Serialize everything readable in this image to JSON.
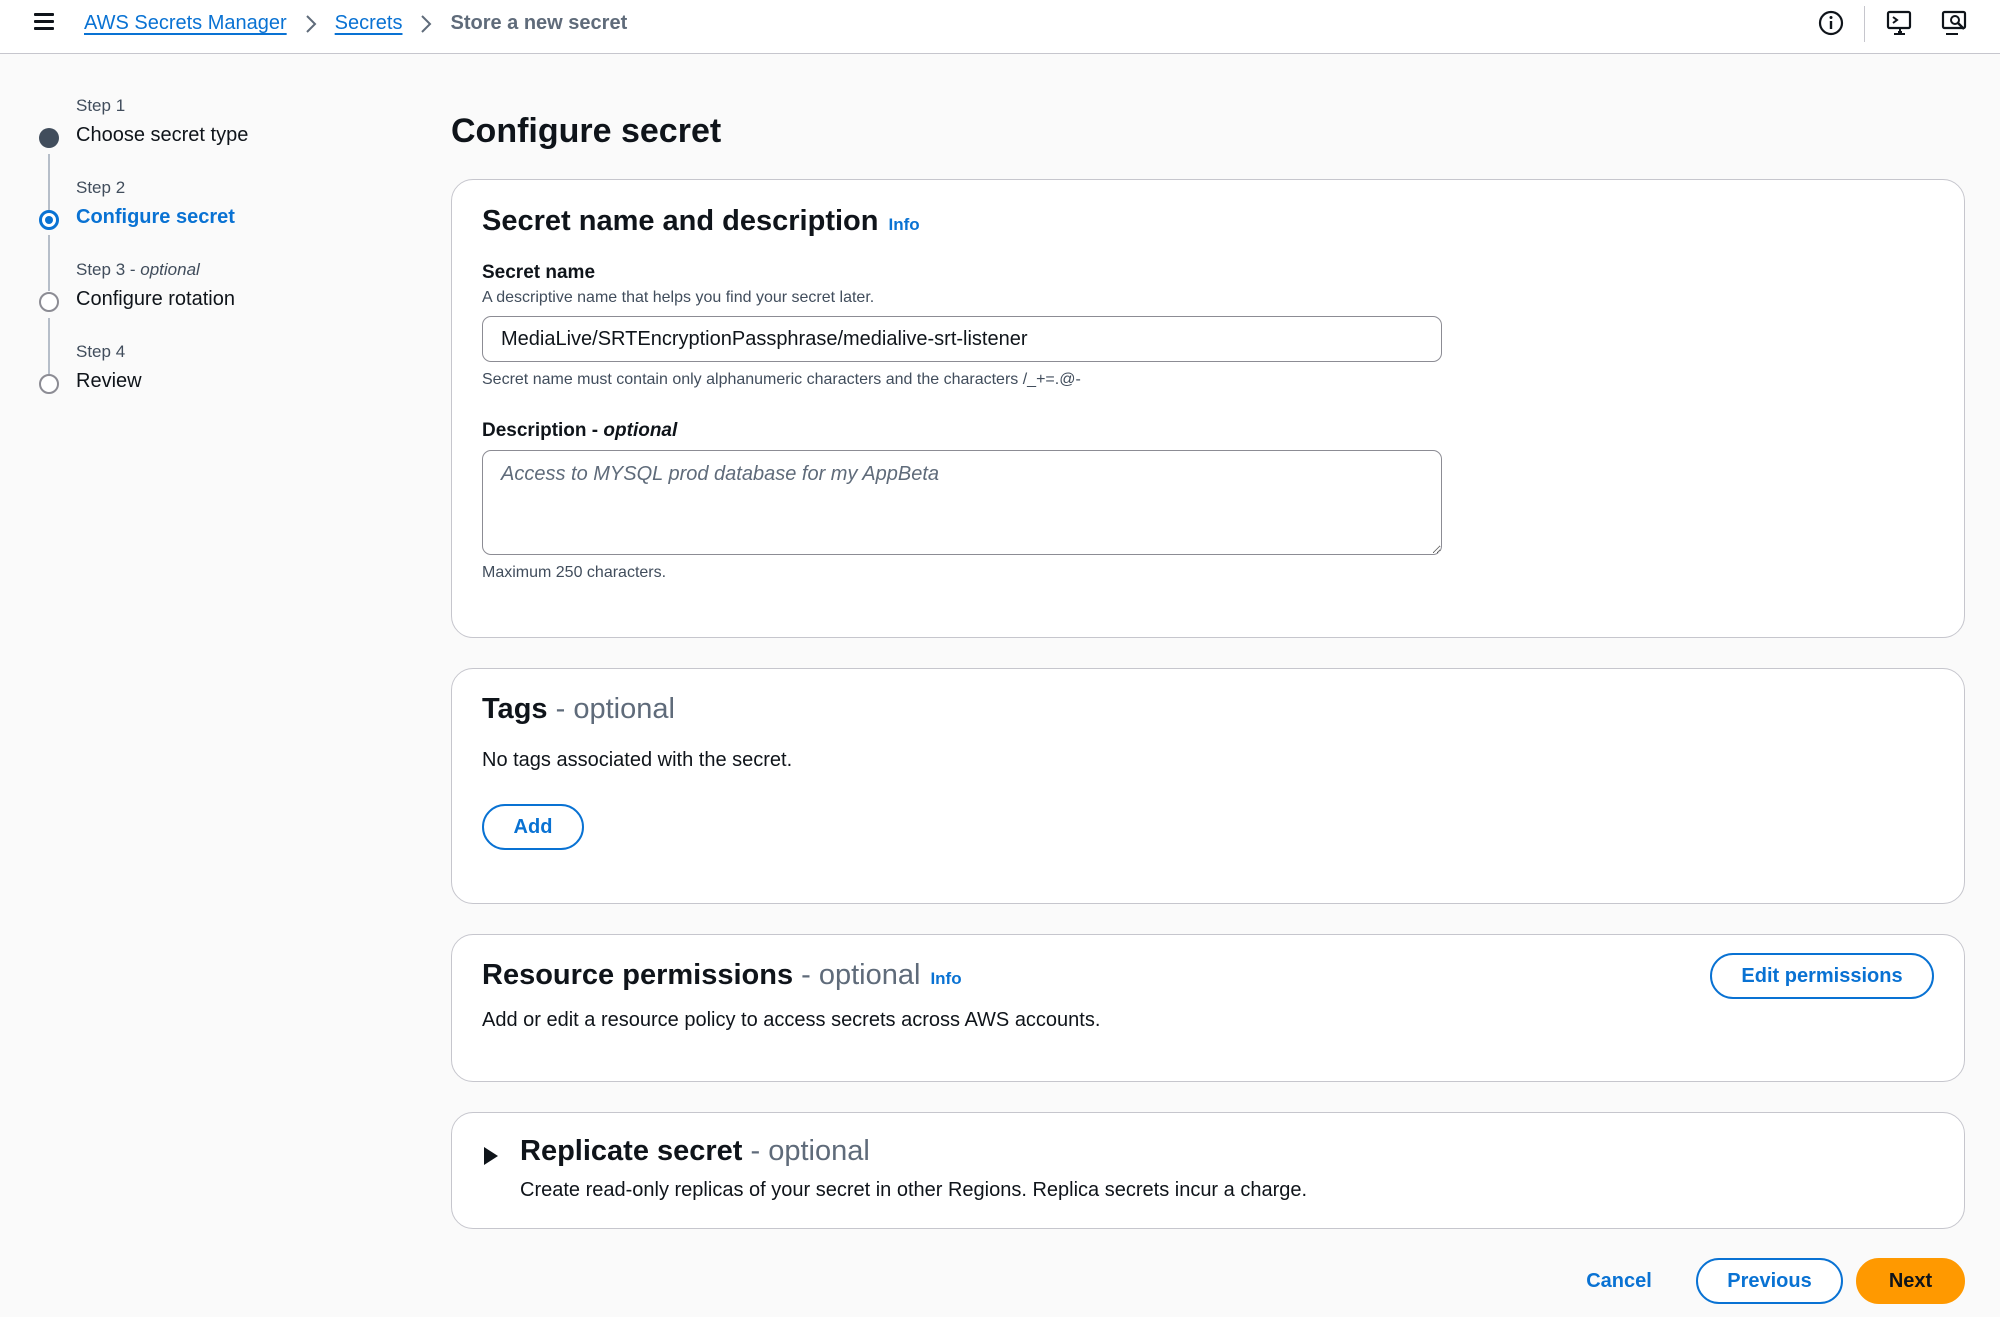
{
  "header": {
    "breadcrumbs": [
      "AWS Secrets Manager",
      "Secrets"
    ],
    "current_page": "Store a new secret",
    "icons": [
      "menu-icon",
      "info-icon",
      "cloudshell-feedback-icon",
      "screen-share-icon"
    ]
  },
  "steps": [
    {
      "label": "Step 1",
      "label_suffix": "",
      "title": "Choose secret type",
      "state": "completed"
    },
    {
      "label": "Step 2",
      "label_suffix": "",
      "title": "Configure secret",
      "state": "active"
    },
    {
      "label": "Step 3 - ",
      "label_suffix": "optional",
      "title": "Configure rotation",
      "state": "pending"
    },
    {
      "label": "Step 4",
      "label_suffix": "",
      "title": "Review",
      "state": "pending"
    }
  ],
  "main": {
    "title": "Configure secret",
    "name_section": {
      "title": "Secret name and description",
      "info": "Info",
      "secret_name_label": "Secret name",
      "secret_name_description": "A descriptive name that helps you find your secret later.",
      "secret_name_value": "MediaLive/SRTEncryptionPassphrase/medialive-srt-listener",
      "secret_name_constraint": "Secret name must contain only alphanumeric characters and the characters /_+=.@-",
      "description_label": "Description - ",
      "description_optional": "optional",
      "description_placeholder": "Access to MYSQL prod database for my AppBeta",
      "description_constraint": "Maximum 250 characters."
    },
    "tags_section": {
      "title": "Tags",
      "optional": " - optional",
      "empty_text": "No tags associated with the secret.",
      "add_button": "Add"
    },
    "permissions_section": {
      "title": "Resource permissions",
      "optional": " - optional",
      "info": "Info",
      "description": "Add or edit a resource policy to access secrets across AWS accounts.",
      "edit_button": "Edit permissions"
    },
    "replicate_section": {
      "title": "Replicate secret",
      "optional": " - optional",
      "description": "Create read-only replicas of your secret in other Regions. Replica secrets incur a charge.",
      "expanded": false
    }
  },
  "footer": {
    "cancel": "Cancel",
    "previous": "Previous",
    "next": "Next"
  },
  "colors": {
    "link": "#0972d3",
    "primary_button": "#ff9900",
    "text": "#0f141a",
    "border": "#c6c6cd"
  }
}
